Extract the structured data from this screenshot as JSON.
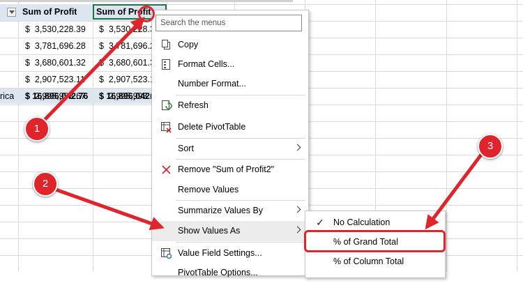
{
  "sheet": {
    "headers": [
      "Sum of Profit",
      "Sum of Profit"
    ],
    "row_labels": [
      "",
      "",
      "",
      "",
      "rica"
    ],
    "col1": [
      "$  3,530,228.39",
      "$  3,781,696.28",
      "$  3,680,601.32",
      "$  2,907,523.11",
      "$  2,995,993.67"
    ],
    "col2": [
      "$  3,530,228.39",
      "$  3,781,696.28",
      "$  3,680,601.32",
      "$  2,907,523.11",
      "$  2,995,993.67"
    ],
    "total1": "$ 16,896,042.76",
    "total2": "$ 16,896,042.76"
  },
  "menu": {
    "search_placeholder": "Search the menus",
    "items": [
      {
        "label": "Copy",
        "icon": "copy-icon"
      },
      {
        "label": "Format Cells...",
        "icon": "format-cells-icon"
      },
      {
        "label": "Number Format...",
        "icon": ""
      },
      {
        "label": "Refresh",
        "icon": "refresh-icon"
      },
      {
        "label": "Delete PivotTable",
        "icon": "delete-pivottable-icon"
      },
      {
        "label": "Sort",
        "icon": ""
      },
      {
        "label": "Remove \"Sum of Profit2\"",
        "icon": "remove-x-icon"
      },
      {
        "label": "Remove Values",
        "icon": ""
      },
      {
        "label": "Summarize Values By",
        "icon": ""
      },
      {
        "label": "Show Values As",
        "icon": ""
      },
      {
        "label": "Value Field Settings...",
        "icon": "value-field-settings-icon"
      },
      {
        "label": "PivotTable Options...",
        "icon": ""
      }
    ]
  },
  "submenu": {
    "items": [
      {
        "label": "No Calculation",
        "checked": true
      },
      {
        "label": "% of Grand Total",
        "checked": false
      },
      {
        "label": "% of Column Total",
        "checked": false
      }
    ]
  },
  "annotations": {
    "badges": [
      "1",
      "2",
      "3"
    ],
    "color": "#e0242b"
  },
  "colors": {
    "header_fill": "#dce6f1",
    "active_cell_border": "#217346"
  }
}
